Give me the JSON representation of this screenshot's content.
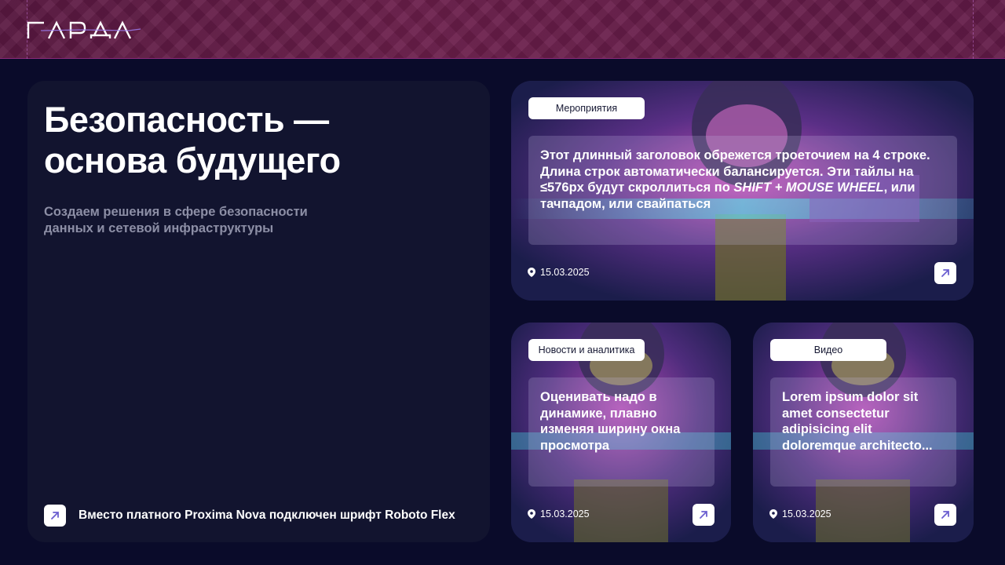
{
  "header": {
    "logo_text": "ГАРДА"
  },
  "hero": {
    "title": "Безопасность — основа будущего",
    "subtitle": "Создаем решения в сфере безопасности данных и сетевой инфраструктуры",
    "footer_text": "Вместо платного Proxima Nova подключен шрифт Roboto Flex"
  },
  "cards": [
    {
      "tag": "Мероприятия",
      "title_part1": "Этот длинный заголовок обрежется троеточием на 4 строке. Длина строк автоматически балансируется. Эти тайлы на ≤576px будут скроллиться по ",
      "title_italic": "SHIFT + MOUSE WHEEL",
      "title_part2": ", или тачпадом, или свайпаться",
      "date": "15.03.2025"
    },
    {
      "tag": "Новости и аналитика",
      "title": "Оценивать надо в динамике, плавно изменяя ширину окна просмотра",
      "date": "15.03.2025"
    },
    {
      "tag": "Видео",
      "title": "Lorem ipsum dolor sit amet consectetur adipisicing elit doloremque architecto...",
      "date": "15.03.2025"
    }
  ],
  "colors": {
    "page_bg": "#0a0b2a",
    "panel_bg": "#12142f",
    "header_bg": "#5a1841",
    "accent_arrow": "#6b5fd0"
  },
  "icons": {
    "pin": "location-pin-icon",
    "arrow": "arrow-up-right-icon"
  }
}
